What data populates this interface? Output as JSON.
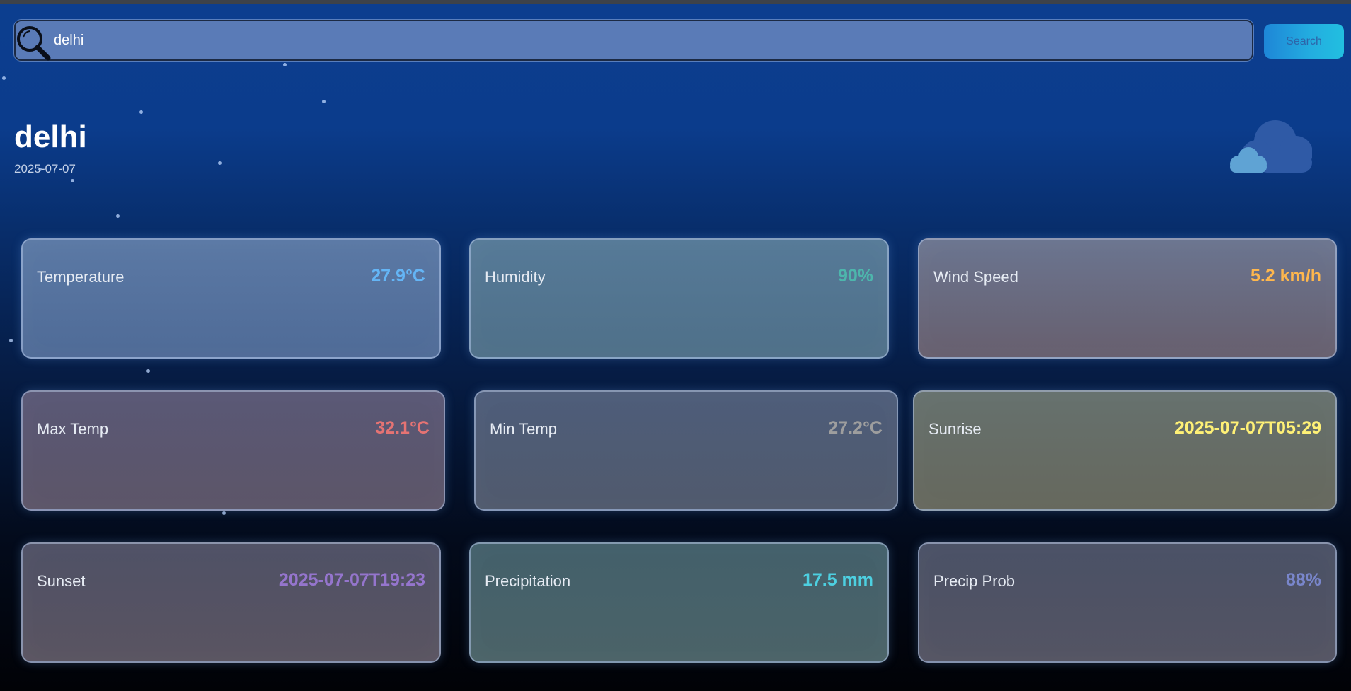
{
  "search": {
    "query": "delhi",
    "button_label": "Search",
    "icon": "magnifier-icon"
  },
  "location": {
    "city": "delhi",
    "date": "2025-07-07",
    "condition_icon": "cloud-icon"
  },
  "metrics": [
    {
      "label": "Temperature",
      "value": "27.9°C",
      "color": "#64b5f6"
    },
    {
      "label": "Humidity",
      "value": "90%",
      "color": "#4db6ac"
    },
    {
      "label": "Wind Speed",
      "value": "5.2 km/h",
      "color": "#ffb74d"
    },
    {
      "label": "Max Temp",
      "value": "32.1°C",
      "color": "#e57373"
    },
    {
      "label": "Min Temp",
      "value": "27.2°C",
      "color": "#9e9e9e"
    },
    {
      "label": "Sunrise",
      "value": "2025-07-07T05:29",
      "color": "#fff176"
    },
    {
      "label": "Sunset",
      "value": "2025-07-07T19:23",
      "color": "#9575cd"
    },
    {
      "label": "Precipitation",
      "value": "17.5 mm",
      "color": "#4dd0e1"
    },
    {
      "label": "Precip Prob",
      "value": "88%",
      "color": "#7986cb"
    }
  ]
}
